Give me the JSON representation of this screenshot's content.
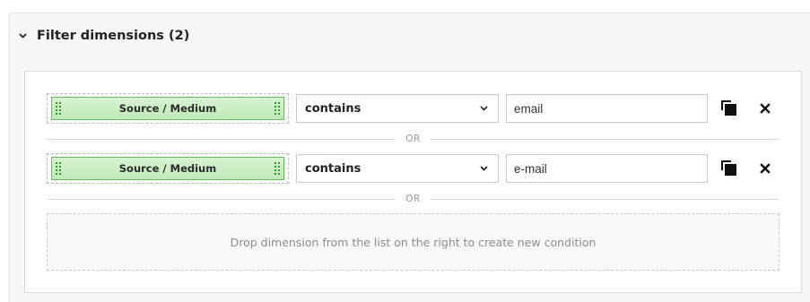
{
  "section": {
    "title": "Filter dimensions (2)",
    "icon": "chevron-down-icon"
  },
  "conditions": [
    {
      "dimension": "Source / Medium",
      "operator": "contains",
      "value": "email"
    },
    {
      "dimension": "Source / Medium",
      "operator": "contains",
      "value": "e-mail"
    }
  ],
  "separator_label": "OR",
  "drop_zone_text": "Drop dimension from the list on the right to create new condition",
  "colors": {
    "chip_fill": "#c6ecbf",
    "chip_border": "#69bb5e",
    "grip": "#2f9a25"
  }
}
